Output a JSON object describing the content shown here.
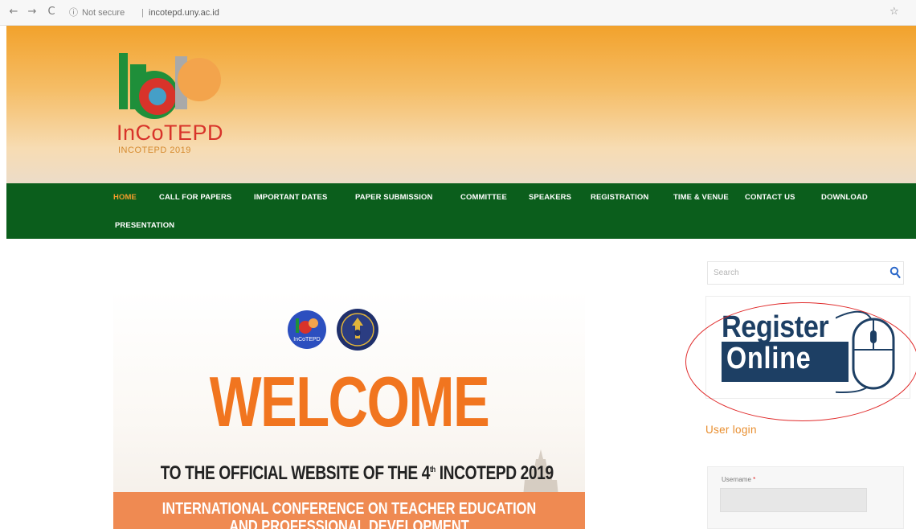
{
  "browser": {
    "back_icon": "←",
    "forward_icon": "→",
    "reload_icon": "C",
    "info_icon": "ⓘ",
    "security_label": "Not secure",
    "separator": "|",
    "url": "incotepd.uny.ac.id",
    "bookmark_icon": "☆"
  },
  "header": {
    "logo_title": "InCoTEPD",
    "logo_subtitle": "INCOTEPD 2019",
    "colors": {
      "top": "#f2a22c",
      "bottom": "#ecdcc8"
    }
  },
  "nav": {
    "active_color": "#f39c2b",
    "background": "#0b5e1c",
    "items": [
      "HOME",
      "CALL FOR PAPERS",
      "IMPORTANT DATES",
      "PAPER SUBMISSION",
      "COMMITTEE",
      "SPEAKERS",
      "REGISTRATION",
      "TIME & VENUE",
      "CONTACT US",
      "DOWNLOAD",
      "PRESENTATION"
    ]
  },
  "hero": {
    "welcome": "WELCOME",
    "subtitle_pre": "TO THE OFFICIAL WEBSITE OF THE 4",
    "subtitle_sup": "th",
    "subtitle_post": " INCOTEPD 2019",
    "band_text_1": "INTERNATIONAL CONFERENCE  ON TEACHER EDUCATION",
    "band_text_2": "AND PROFESSIONAL DEVELOPMENT",
    "welcome_color": "#f1751f",
    "band_color": "#ef8a52",
    "badge_1": "InCoTEPD"
  },
  "sidebar": {
    "search_placeholder": "Search",
    "register_line1": "Register",
    "register_line2": "Online",
    "user_login_title": "User login",
    "username_label": "Username",
    "required_mark": "*",
    "highlight_color": "#e02a2a"
  }
}
